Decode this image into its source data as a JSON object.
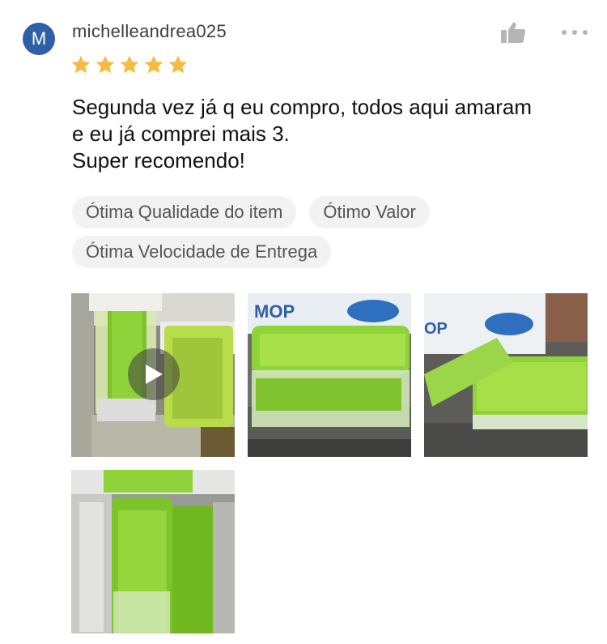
{
  "review": {
    "avatar_letter": "M",
    "username": "michelleandrea025",
    "rating": 5,
    "text": "Segunda vez já q eu compro, todos aqui amaram\ne eu já comprei mais 3.\nSuper recomendo!",
    "tags": [
      "Ótima Qualidade do item",
      "Ótimo Valor",
      "Ótima Velocidade de Entrega"
    ]
  },
  "photos": {
    "mop_text_1": "MOP",
    "mop_text_2": "OP"
  },
  "colors": {
    "avatar": "#2f5fa6",
    "star": "#f6bb3f",
    "tag_bg": "#f2f2f2",
    "icon_gray": "#b5b5b5"
  },
  "icons": [
    "thumbs-up-icon",
    "more-icon",
    "star-icon",
    "play-icon"
  ]
}
